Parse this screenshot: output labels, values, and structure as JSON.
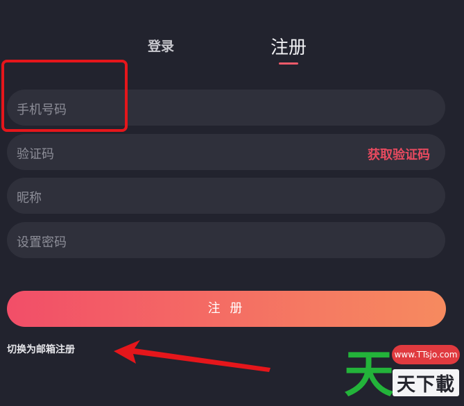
{
  "tabs": {
    "login": "登录",
    "register": "注册"
  },
  "fields": {
    "phone": {
      "placeholder": "手机号码"
    },
    "code": {
      "placeholder": "验证码",
      "action": "获取验证码"
    },
    "nickname": {
      "placeholder": "昵称"
    },
    "password": {
      "placeholder": "设置密码"
    }
  },
  "submit_label": "注 册",
  "switch_link": "切换为邮箱注册",
  "watermark": {
    "logo_char": "天",
    "url": "www.TTsjo.com",
    "name": "天下載"
  },
  "colors": {
    "background": "#22232e",
    "field": "#2f303b",
    "accent": "#f25a6a",
    "annotation": "#e5161b",
    "brand_green": "#23b33a"
  }
}
